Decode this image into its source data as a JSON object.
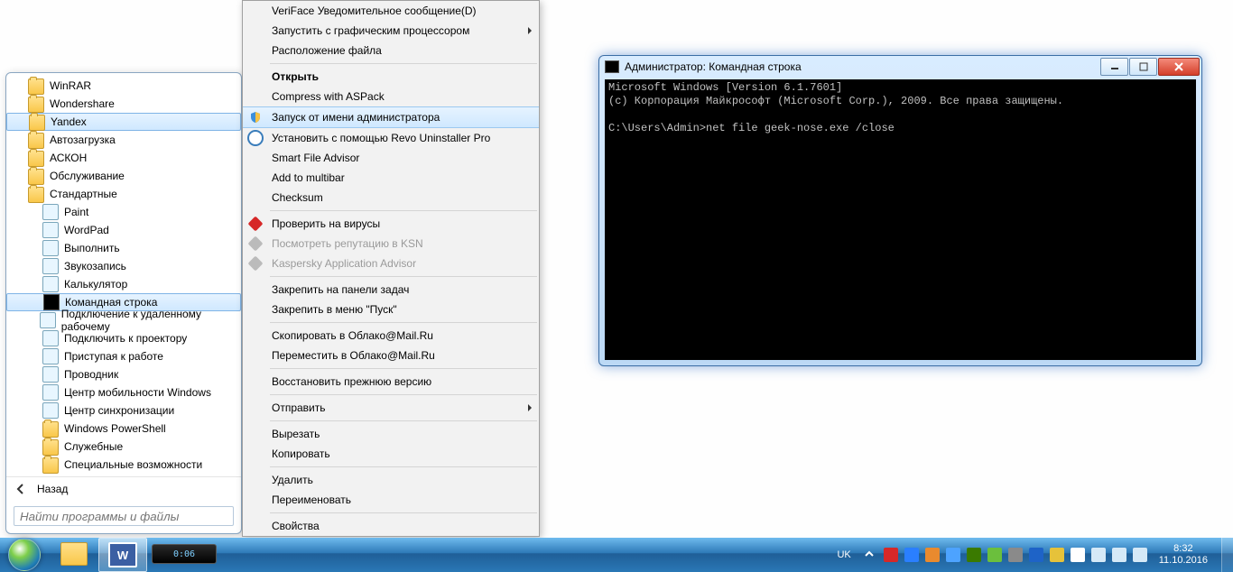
{
  "start_menu": {
    "items": [
      {
        "label": "WinRAR",
        "indent": 1,
        "icon": "folder"
      },
      {
        "label": "Wondershare",
        "indent": 1,
        "icon": "folder"
      },
      {
        "label": "Yandex",
        "indent": 1,
        "icon": "folder",
        "sel": true
      },
      {
        "label": "Автозагрузка",
        "indent": 1,
        "icon": "folder"
      },
      {
        "label": "АСКОН",
        "indent": 1,
        "icon": "folder"
      },
      {
        "label": "Обслуживание",
        "indent": 1,
        "icon": "folder"
      },
      {
        "label": "Стандартные",
        "indent": 1,
        "icon": "folder"
      },
      {
        "label": "Paint",
        "indent": 2,
        "icon": "app"
      },
      {
        "label": "WordPad",
        "indent": 2,
        "icon": "app"
      },
      {
        "label": "Выполнить",
        "indent": 2,
        "icon": "app"
      },
      {
        "label": "Звукозапись",
        "indent": 2,
        "icon": "app"
      },
      {
        "label": "Калькулятор",
        "indent": 2,
        "icon": "app"
      },
      {
        "label": "Командная строка",
        "indent": 2,
        "icon": "cmd",
        "sel": true
      },
      {
        "label": "Подключение к удаленному рабочему",
        "indent": 2,
        "icon": "app"
      },
      {
        "label": "Подключить к проектору",
        "indent": 2,
        "icon": "app"
      },
      {
        "label": "Приступая к работе",
        "indent": 2,
        "icon": "app"
      },
      {
        "label": "Проводник",
        "indent": 2,
        "icon": "app"
      },
      {
        "label": "Центр мобильности Windows",
        "indent": 2,
        "icon": "app"
      },
      {
        "label": "Центр синхронизации",
        "indent": 2,
        "icon": "app"
      },
      {
        "label": "Windows PowerShell",
        "indent": 2,
        "icon": "folder"
      },
      {
        "label": "Служебные",
        "indent": 2,
        "icon": "folder"
      },
      {
        "label": "Специальные возможности",
        "indent": 2,
        "icon": "folder"
      }
    ],
    "back_label": "Назад",
    "search_placeholder": "Найти программы и файлы"
  },
  "context_menu": {
    "items": [
      {
        "label": "VeriFace Уведомительное сообщение(D)"
      },
      {
        "label": "Запустить с графическим процессором",
        "sub": true
      },
      {
        "label": "Расположение файла"
      },
      {
        "sep": true
      },
      {
        "label": "Открыть",
        "bold": true
      },
      {
        "label": "Compress with ASPack"
      },
      {
        "label": "Запуск от имени администратора",
        "icon": "shield",
        "highlight": true
      },
      {
        "label": "Установить с помощью Revo Uninstaller Pro",
        "icon": "revo"
      },
      {
        "label": "Smart File Advisor"
      },
      {
        "label": "Add to multibar"
      },
      {
        "label": "Checksum"
      },
      {
        "sep": true
      },
      {
        "label": "Проверить на вирусы",
        "icon": "kasp"
      },
      {
        "label": "Посмотреть репутацию в KSN",
        "icon": "kasp",
        "disabled": true
      },
      {
        "label": "Kaspersky Application Advisor",
        "icon": "kasp",
        "disabled": true
      },
      {
        "sep": true
      },
      {
        "label": "Закрепить на панели задач"
      },
      {
        "label": "Закрепить в меню \"Пуск\""
      },
      {
        "sep": true
      },
      {
        "label": "Скопировать в Облако@Mail.Ru"
      },
      {
        "label": "Переместить в Облако@Mail.Ru"
      },
      {
        "sep": true
      },
      {
        "label": "Восстановить прежнюю версию"
      },
      {
        "sep": true
      },
      {
        "label": "Отправить",
        "sub": true
      },
      {
        "sep": true
      },
      {
        "label": "Вырезать"
      },
      {
        "label": "Копировать"
      },
      {
        "sep": true
      },
      {
        "label": "Удалить"
      },
      {
        "label": "Переименовать"
      },
      {
        "sep": true
      },
      {
        "label": "Свойства"
      }
    ]
  },
  "cmd_window": {
    "title": "Администратор: Командная строка",
    "lines": [
      "Microsoft Windows [Version 6.1.7601]",
      "(c) Корпорация Майкрософт (Microsoft Corp.), 2009. Все права защищены.",
      "",
      "C:\\Users\\Admin>net file geek-nose.exe /close"
    ]
  },
  "taskbar": {
    "word_letter": "W",
    "progress": "0:06",
    "lang": "UK",
    "time": "8:32",
    "date": "11.10.2016",
    "tray_icons": [
      "tray-arrow",
      "tray-red",
      "tray-tv",
      "tray-orange",
      "tray-blue2",
      "tray-nv",
      "tray-green",
      "tray-grey",
      "tray-bt",
      "tray-yellow",
      "tray-flag",
      "tray-net",
      "tray-vol",
      "tray-power"
    ],
    "tray_colors": {
      "tray-arrow": "#fff",
      "tray-red": "#d62828",
      "tray-tv": "#2a7fff",
      "tray-orange": "#e98a2e",
      "tray-blue2": "#4da3ff",
      "tray-nv": "#3a7a00",
      "tray-green": "#6bbf3d",
      "tray-grey": "#8a8a8a",
      "tray-bt": "#1e63c7",
      "tray-yellow": "#e6c23a",
      "tray-flag": "#ffffff",
      "tray-net": "#d5e9f7",
      "tray-vol": "#d5e9f7",
      "tray-power": "#d5e9f7"
    }
  }
}
